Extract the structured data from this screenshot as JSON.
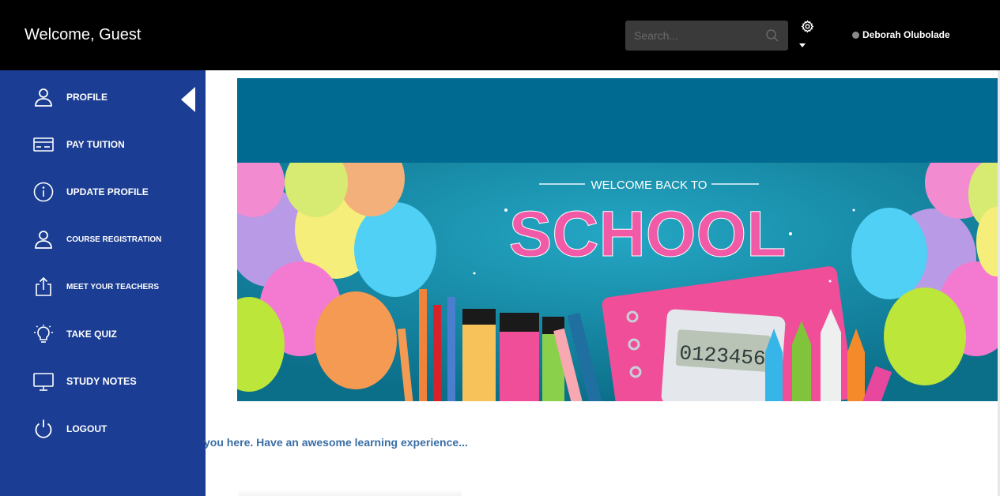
{
  "header": {
    "welcome": "Welcome, Guest",
    "search_placeholder": "Search...",
    "user_name": "Deborah Olubolade"
  },
  "sidebar": {
    "items": [
      {
        "label": "PROFILE",
        "icon": "user-icon",
        "active": true
      },
      {
        "label": "PAY TUITION",
        "icon": "credit-card-icon"
      },
      {
        "label": "UPDATE PROFILE",
        "icon": "info-icon"
      },
      {
        "label": "COURSE REGISTRATION",
        "icon": "user-icon"
      },
      {
        "label": "MEET YOUR TEACHERS",
        "icon": "share-icon"
      },
      {
        "label": "TAKE QUIZ",
        "icon": "lightbulb-icon"
      },
      {
        "label": "STUDY NOTES",
        "icon": "monitor-icon"
      },
      {
        "label": "LOGOUT",
        "icon": "power-icon"
      }
    ]
  },
  "banner": {
    "subtitle": "WELCOME BACK TO",
    "title": "SCHOOL",
    "calculator_display": "0123456"
  },
  "main": {
    "tagline": "you here. Have an awesome learning experience..."
  },
  "colors": {
    "topbar": "#000000",
    "sidebar": "#1b3d93",
    "banner_top": "#006a90",
    "tagline": "#3a6ea5"
  }
}
